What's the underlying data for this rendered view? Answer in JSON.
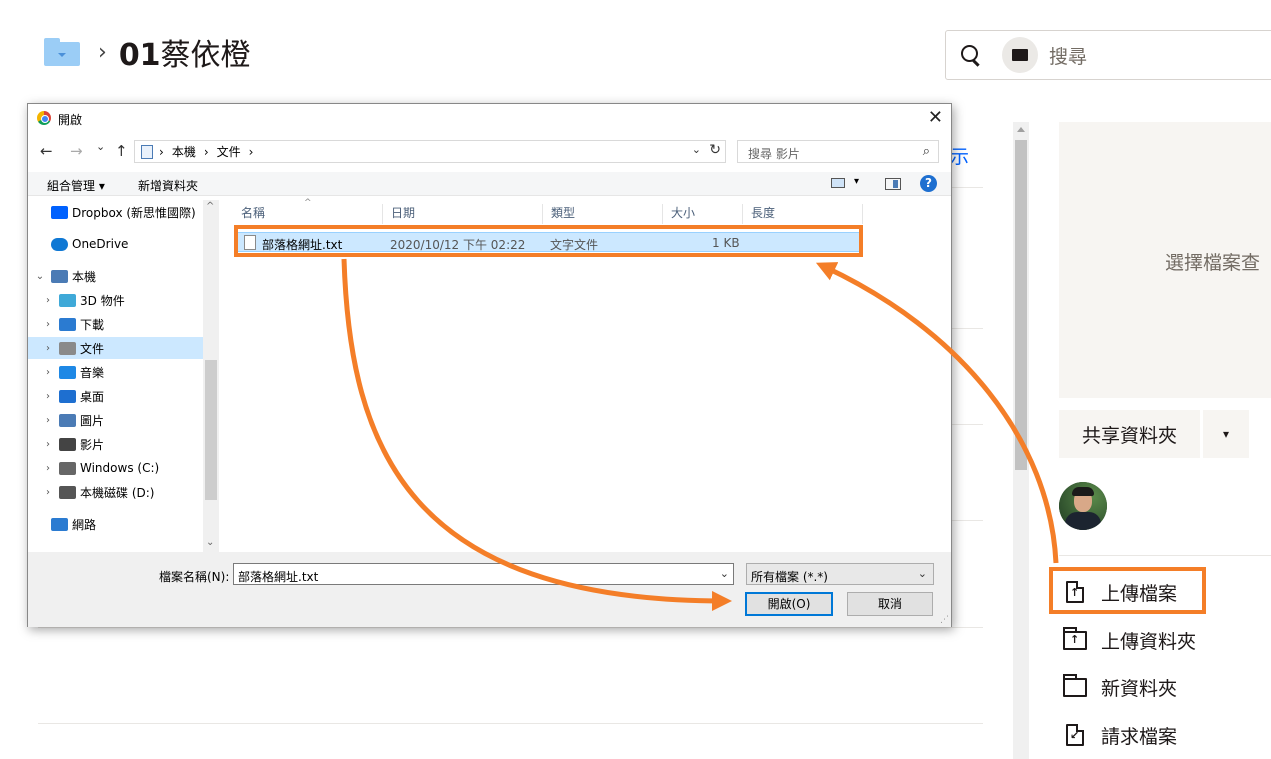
{
  "breadcrumb": {
    "separator": "›",
    "title_bold": "01",
    "title_rest": "蔡依橙"
  },
  "search": {
    "placeholder": "搜尋"
  },
  "background": {
    "partial_link": "示"
  },
  "sidebar": {
    "preview_text": "選擇檔案查",
    "share_button": "共享資料夾",
    "share_dropdown": "▾",
    "actions": [
      {
        "label": "上傳檔案",
        "icon": "upload-file-icon",
        "glyph": "↑"
      },
      {
        "label": "上傳資料夾",
        "icon": "upload-folder-icon",
        "glyph": "↑"
      },
      {
        "label": "新資料夾",
        "icon": "folder-icon",
        "glyph": ""
      },
      {
        "label": "請求檔案",
        "icon": "request-file-icon",
        "glyph": "↙"
      }
    ]
  },
  "dialog": {
    "title": "開啟",
    "close": "✕",
    "nav": {
      "back": "←",
      "forward": "→",
      "recent": "⌄",
      "up": "↑"
    },
    "address": {
      "segments": [
        "›",
        "本機",
        "›",
        "文件",
        "›"
      ],
      "dropdown": "⌄",
      "refresh": "↻"
    },
    "search_placeholder": "搜尋 影片",
    "search_icon": "⌕",
    "toolbar": {
      "organize": "組合管理 ▾",
      "new_folder": "新增資料夾",
      "view_dd": "▾",
      "help": "?"
    },
    "nav_pane": [
      {
        "label": "Dropbox (新思惟國際)",
        "icon": "dropbox-icon",
        "chevron": "",
        "indent": 0,
        "selected": false
      },
      {
        "label": "OneDrive",
        "icon": "onedrive-icon",
        "chevron": "",
        "indent": 0,
        "selected": false
      },
      {
        "label": "本機",
        "icon": "pc-icon",
        "chevron": "⌄",
        "indent": 0,
        "selected": false
      },
      {
        "label": "3D 物件",
        "icon": "3d-objects-icon",
        "chevron": "›",
        "indent": 1,
        "selected": false
      },
      {
        "label": "下載",
        "icon": "downloads-icon",
        "chevron": "›",
        "indent": 1,
        "selected": false
      },
      {
        "label": "文件",
        "icon": "documents-icon",
        "chevron": "›",
        "indent": 1,
        "selected": true
      },
      {
        "label": "音樂",
        "icon": "music-icon",
        "chevron": "›",
        "indent": 1,
        "selected": false
      },
      {
        "label": "桌面",
        "icon": "desktop-icon",
        "chevron": "›",
        "indent": 1,
        "selected": false
      },
      {
        "label": "圖片",
        "icon": "pictures-icon",
        "chevron": "›",
        "indent": 1,
        "selected": false
      },
      {
        "label": "影片",
        "icon": "videos-icon",
        "chevron": "›",
        "indent": 1,
        "selected": false
      },
      {
        "label": "Windows (C:)",
        "icon": "drive-c-icon",
        "chevron": "›",
        "indent": 1,
        "selected": false
      },
      {
        "label": "本機磁碟 (D:)",
        "icon": "drive-d-icon",
        "chevron": "›",
        "indent": 1,
        "selected": false
      },
      {
        "label": "網路",
        "icon": "network-icon",
        "chevron": "",
        "indent": 0,
        "selected": false
      }
    ],
    "columns": [
      "名稱",
      "日期",
      "類型",
      "大小",
      "長度"
    ],
    "files": [
      {
        "name": "部落格網址.txt",
        "date": "2020/10/12 下午 02:22",
        "type": "文字文件",
        "size": "1 KB",
        "length": ""
      }
    ],
    "filename_label": "檔案名稱(N):",
    "filename_value": "部落格網址.txt",
    "filetype": "所有檔案 (*.*)",
    "open_button": "開啟(O)",
    "cancel_button": "取消",
    "dropdown_glyph": "⌄",
    "scroll_up": "^",
    "scroll_down": "⌄"
  },
  "colors": {
    "highlight_orange": "#f47e28",
    "selection_blue": "#cce8ff",
    "dropbox_blue": "#0061fe"
  }
}
